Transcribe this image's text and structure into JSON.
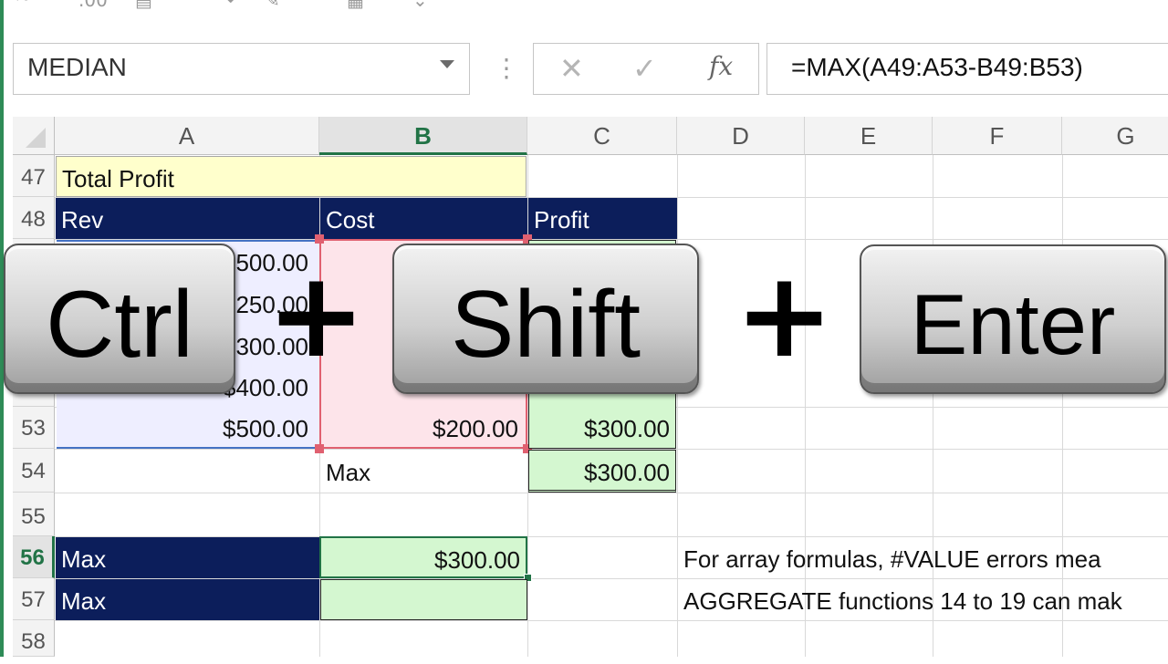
{
  "toolbar": {
    "glyph_1": "⁺⁰",
    "glyph_2": ".00"
  },
  "formula_bar": {
    "name_box": "MEDIAN",
    "dots": "⋮",
    "cancel_glyph": "✕",
    "enter_glyph": "✓",
    "fx_label": "fx",
    "formula": "=MAX(A49:A53-B49:B53)"
  },
  "columns": [
    "A",
    "B",
    "C",
    "D",
    "E",
    "F",
    "G"
  ],
  "rows": [
    "47",
    "48",
    "53",
    "54",
    "55",
    "56",
    "57",
    "58"
  ],
  "cells": {
    "a47": "Total Profit",
    "a48": "Rev",
    "b48": "Cost",
    "c48": "Profit",
    "a49": "$500.00",
    "a50": "$250.00",
    "a51": "$300.00",
    "a52": "$400.00",
    "a53": "$500.00",
    "b53": "$200.00",
    "c53": "$300.00",
    "b54": "Max",
    "c54": "$300.00",
    "a56": "Max",
    "b56": "$300.00",
    "a57": "Max",
    "d56": "For array formulas, #VALUE errors mea",
    "d57": "AGGREGATE functions 14 to 19 can mak"
  },
  "keys": {
    "ctrl": "Ctrl",
    "shift": "Shift",
    "enter": "Enter",
    "plus": "+"
  },
  "colors": {
    "header_navy": "#0c1e5b",
    "result_green": "#d4f7d0",
    "selection_green": "#217346",
    "precedent_red": "#e06070",
    "precedent_blue": "#4472c4"
  }
}
